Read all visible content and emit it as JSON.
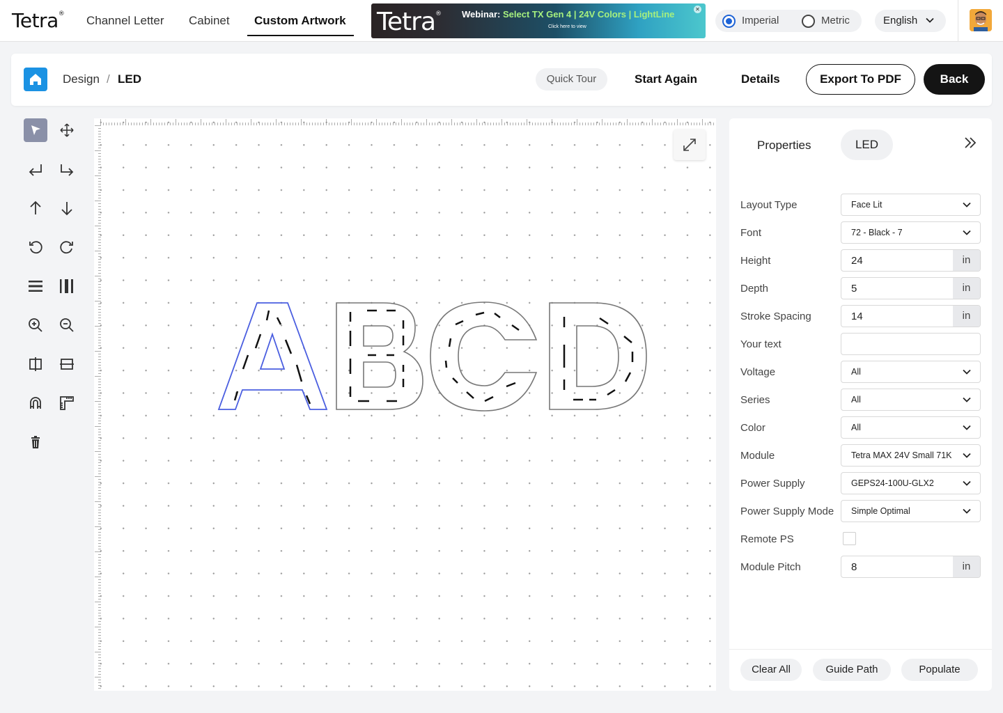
{
  "brand": {
    "name": "Tetra",
    "mark": "®"
  },
  "nav": {
    "tabs": [
      {
        "label": "Channel Letter"
      },
      {
        "label": "Cabinet"
      },
      {
        "label": "Custom Artwork",
        "active": true
      }
    ]
  },
  "banner": {
    "logo": "Tetra",
    "text_prefix": "Webinar: ",
    "text_highlight": "Select TX Gen 4 | 24V Colors | LightLine",
    "sub": "Click here to view"
  },
  "units": {
    "selected": "Imperial",
    "options": [
      "Imperial",
      "Metric"
    ]
  },
  "language": {
    "value": "English"
  },
  "breadcrumb": {
    "items": [
      "Design",
      "LED"
    ],
    "separator": "/"
  },
  "actions": {
    "quick_tour": "Quick Tour",
    "start_again": "Start Again",
    "details": "Details",
    "export_pdf": "Export To PDF",
    "back": "Back"
  },
  "toolbar": {
    "tools": [
      "select-icon",
      "move-icon",
      "undo-icon",
      "redo-icon",
      "arrow-up-icon",
      "arrow-down-icon",
      "rotate-left-icon",
      "rotate-right-icon",
      "align-horizontal-icon",
      "align-vertical-icon",
      "zoom-in-icon",
      "zoom-out-icon",
      "flip-horizontal-icon",
      "flip-vertical-icon",
      "magnet-icon",
      "ruler-icon",
      "trash-icon"
    ]
  },
  "canvas": {
    "artwork_text": "ABCD",
    "selected_letter": "A",
    "selection_color": "#4a5ee0"
  },
  "properties": {
    "title": "Properties",
    "chip": "LED",
    "fields": {
      "layout_type": {
        "label": "Layout Type",
        "value": "Face Lit"
      },
      "font": {
        "label": "Font",
        "value": "72 - Black - 7"
      },
      "height": {
        "label": "Height",
        "value": "24",
        "unit": "in"
      },
      "depth": {
        "label": "Depth",
        "value": "5",
        "unit": "in"
      },
      "stroke_spacing": {
        "label": "Stroke Spacing",
        "value": "14",
        "unit": "in"
      },
      "your_text": {
        "label": "Your text",
        "value": ""
      },
      "voltage": {
        "label": "Voltage",
        "value": "All"
      },
      "series": {
        "label": "Series",
        "value": "All"
      },
      "color": {
        "label": "Color",
        "value": "All"
      },
      "module": {
        "label": "Module",
        "value": "Tetra MAX 24V Small 71K"
      },
      "power_supply": {
        "label": "Power Supply",
        "value": "GEPS24-100U-GLX2"
      },
      "power_supply_mode": {
        "label": "Power Supply Mode",
        "value": "Simple Optimal"
      },
      "remote_ps": {
        "label": "Remote PS",
        "checked": false
      },
      "module_pitch": {
        "label": "Module Pitch",
        "value": "8",
        "unit": "in"
      }
    },
    "footer": {
      "clear_all": "Clear All",
      "guide_path": "Guide Path",
      "populate": "Populate"
    }
  },
  "colors": {
    "accent": "#1d63d6",
    "home": "#1b92e3",
    "dark_button": "#141414"
  }
}
